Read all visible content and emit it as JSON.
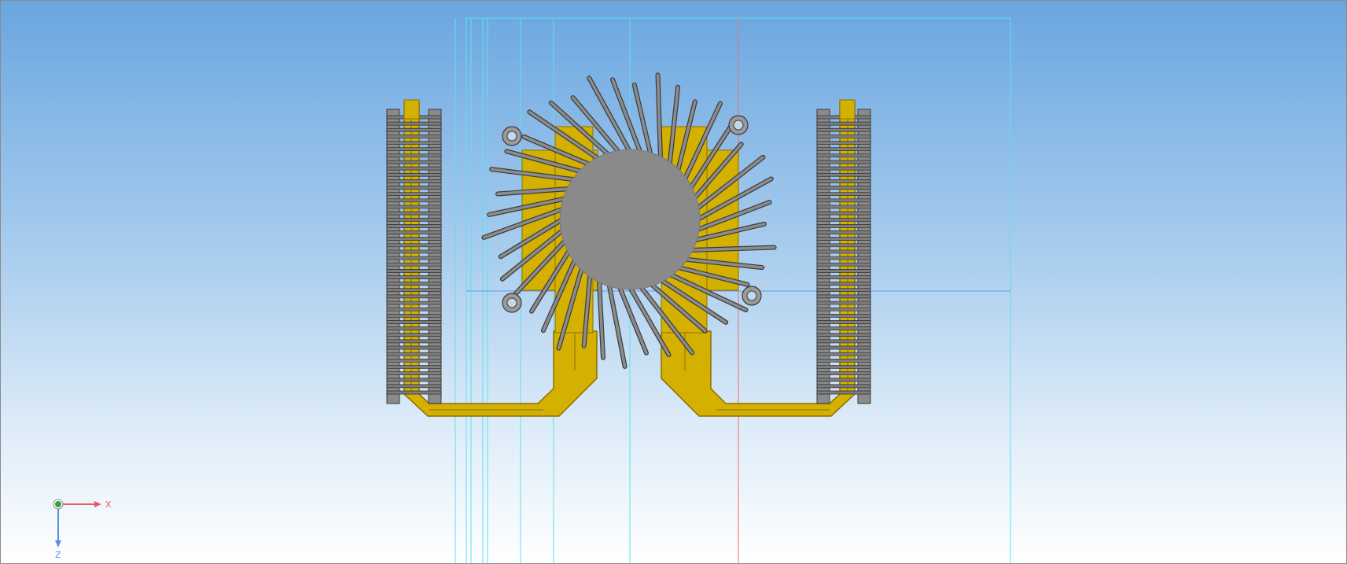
{
  "viewport": {
    "name": "3d-model-viewport",
    "background_top": "#6aa6e0",
    "background_bottom": "#ffffff"
  },
  "model": {
    "description_hidden": "",
    "colors": {
      "copper_pipe": "#d4b000",
      "copper_pipe_dark": "#8a6f00",
      "hub": "#8a8a8a",
      "fin": "#8c8c8c",
      "fin_edge": "#3a3a3a",
      "construction_line_cyan": "#5ee0f0",
      "construction_line_red": "#f07070",
      "construction_line_blue": "#5a9cf0"
    },
    "radial_fin_count": 40,
    "stack_fin_count": 44
  },
  "axis_triad": {
    "x_label": "X",
    "z_label": "Z",
    "x_color": "#e06060",
    "z_color": "#5a90e0",
    "origin_color": "#3aa040"
  }
}
